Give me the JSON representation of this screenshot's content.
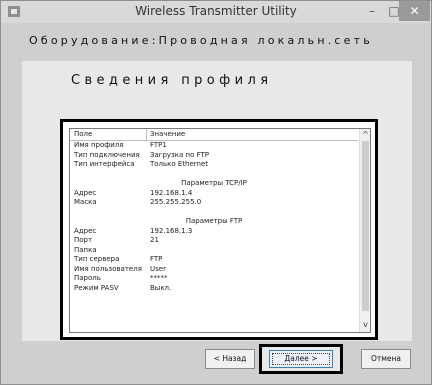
{
  "window": {
    "title": "Wireless Transmitter Utility",
    "minimize_glyph": "–",
    "maximize_glyph": "□",
    "close_glyph": "✕",
    "app_icon": "app-icon"
  },
  "header": {
    "title": "Оборудование:Проводная локальн.сеть"
  },
  "main": {
    "section_title": "Сведения профиля",
    "columns": [
      "Поле",
      "Значение"
    ],
    "rows": [
      {
        "k": "Имя профиля",
        "v": "FTP1"
      },
      {
        "k": "Тип подключения",
        "v": "Загрузка по FTP"
      },
      {
        "k": "Тип интерфейса",
        "v": "Только Ethernet"
      },
      {
        "k": "",
        "v": ""
      },
      {
        "k": "",
        "v": "Параметры TCP/IP"
      },
      {
        "k": "Адрес",
        "v": "192.168.1.4"
      },
      {
        "k": "Маска",
        "v": "255.255.255.0"
      },
      {
        "k": "",
        "v": ""
      },
      {
        "k": "",
        "v": "Параметры FTP"
      },
      {
        "k": "Адрес",
        "v": "192.168.1.3"
      },
      {
        "k": "Порт",
        "v": "21"
      },
      {
        "k": "Папка",
        "v": ""
      },
      {
        "k": "Тип сервера",
        "v": "FTP"
      },
      {
        "k": "Имя пользователя",
        "v": "User"
      },
      {
        "k": "Пароль",
        "v": "*****"
      },
      {
        "k": "Режим PASV",
        "v": "Выкл."
      }
    ]
  },
  "buttons": {
    "back": "< Назад",
    "next": "Далее >",
    "cancel": "Отмена"
  }
}
